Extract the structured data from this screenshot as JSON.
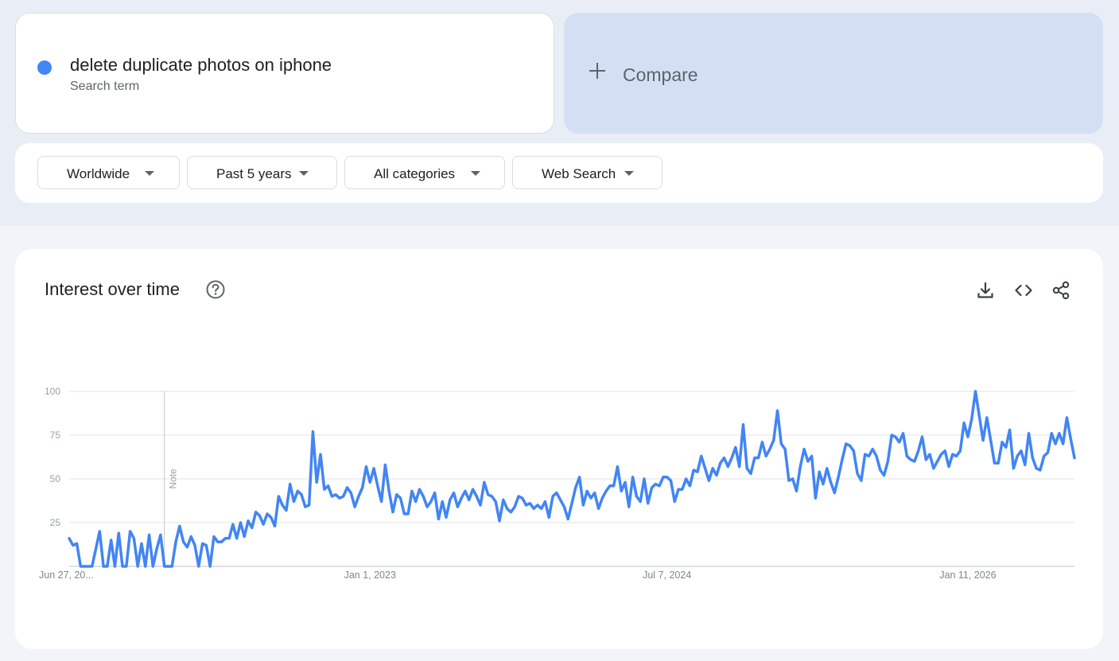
{
  "search_term": {
    "name": "delete duplicate photos on iphone",
    "type_label": "Search term",
    "color": "#4285f4"
  },
  "compare": {
    "label": "Compare",
    "icon": "plus-icon"
  },
  "filters": [
    {
      "label": "Worldwide",
      "icon": "caret-down-icon"
    },
    {
      "label": "Past 5 years",
      "icon": "caret-down-icon"
    },
    {
      "label": "All categories",
      "icon": "caret-down-icon"
    },
    {
      "label": "Web Search",
      "icon": "caret-down-icon"
    }
  ],
  "panel": {
    "title": "Interest over time",
    "help_icon": "help-circle-icon",
    "actions": [
      "download-icon",
      "embed-code-icon",
      "share-icon"
    ]
  },
  "chart_data": {
    "type": "line",
    "x_tick_labels": [
      "Jun 27, 20...",
      "Jan 1, 2023",
      "Jul 7, 2024",
      "Jan 11, 2026"
    ],
    "x_tick_indices": [
      0,
      79,
      157,
      236
    ],
    "y_ticks": [
      25,
      50,
      75,
      100
    ],
    "ylim": [
      0,
      100
    ],
    "grid": true,
    "annotation": {
      "label": "Note",
      "index": 25
    },
    "series": [
      {
        "color": "#4285f4",
        "values": [
          16,
          12,
          13,
          0,
          0,
          0,
          0,
          10,
          20,
          0,
          0,
          15,
          0,
          19,
          0,
          0,
          20,
          16,
          0,
          13,
          0,
          18,
          0,
          10,
          18,
          0,
          0,
          0,
          14,
          23,
          14,
          11,
          17,
          12,
          0,
          13,
          12,
          0,
          17,
          14,
          14,
          16,
          16,
          24,
          16,
          25,
          17,
          26,
          22,
          31,
          29,
          24,
          30,
          28,
          23,
          40,
          35,
          32,
          47,
          37,
          43,
          41,
          34,
          35,
          77,
          48,
          64,
          44,
          46,
          40,
          41,
          39,
          40,
          45,
          42,
          34,
          40,
          45,
          57,
          48,
          56,
          46,
          37,
          58,
          43,
          31,
          41,
          39,
          30,
          30,
          43,
          37,
          44,
          40,
          34,
          37,
          42,
          27,
          37,
          28,
          38,
          42,
          34,
          39,
          43,
          38,
          44,
          40,
          35,
          48,
          41,
          40,
          37,
          26,
          38,
          33,
          31,
          34,
          40,
          39,
          35,
          36,
          33,
          35,
          33,
          37,
          28,
          40,
          42,
          38,
          34,
          27,
          36,
          45,
          51,
          35,
          43,
          39,
          42,
          33,
          39,
          43,
          46,
          46,
          57,
          43,
          48,
          34,
          51,
          40,
          37,
          50,
          36,
          45,
          47,
          46,
          51,
          51,
          49,
          37,
          44,
          44,
          50,
          46,
          55,
          54,
          63,
          56,
          49,
          56,
          52,
          59,
          62,
          57,
          62,
          68,
          57,
          81,
          56,
          53,
          62,
          62,
          71,
          63,
          67,
          72,
          89,
          70,
          67,
          49,
          50,
          43,
          57,
          67,
          60,
          63,
          39,
          54,
          47,
          56,
          48,
          42,
          51,
          61,
          70,
          69,
          66,
          53,
          49,
          64,
          63,
          67,
          63,
          55,
          52,
          60,
          75,
          74,
          71,
          76,
          63,
          61,
          60,
          66,
          74,
          61,
          64,
          56,
          60,
          64,
          66,
          57,
          64,
          63,
          66,
          82,
          74,
          84,
          100,
          86,
          72,
          85,
          72,
          59,
          59,
          71,
          68,
          78,
          56,
          63,
          66,
          58,
          76,
          62,
          56,
          55,
          63,
          65,
          76,
          70,
          76,
          70,
          85,
          73,
          62
        ]
      }
    ]
  }
}
